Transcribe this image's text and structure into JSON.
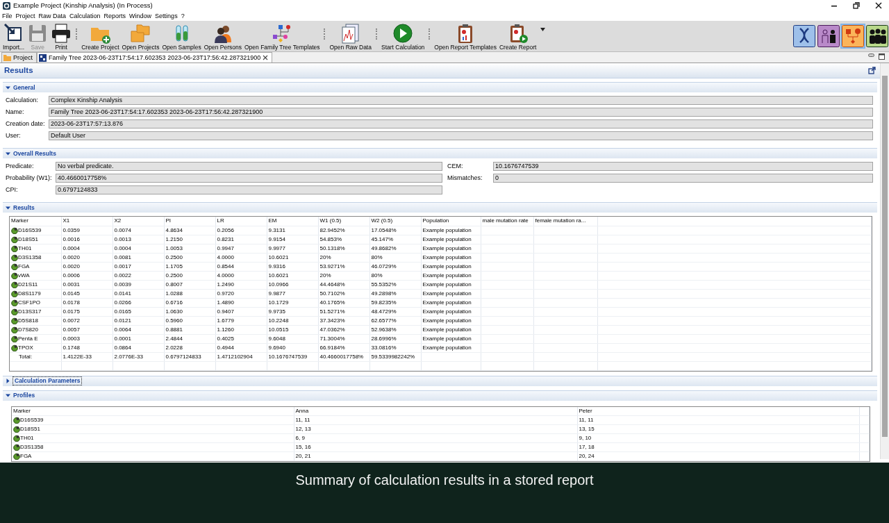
{
  "window": {
    "title": "Example Project (Kinship Analysis) (In Process)"
  },
  "menu": [
    "File",
    "Project",
    "Raw Data",
    "Calculation",
    "Reports",
    "Window",
    "Settings",
    "?"
  ],
  "toolbar_groups": [
    [
      {
        "label": "Import...",
        "disabled": false
      },
      {
        "label": "Save",
        "disabled": true
      },
      {
        "label": "Print",
        "disabled": false
      }
    ],
    [
      {
        "label": "Create Project",
        "disabled": false
      },
      {
        "label": "Open Projects",
        "disabled": false
      },
      {
        "label": "Open Samples",
        "disabled": false
      },
      {
        "label": "Open Persons",
        "disabled": false
      },
      {
        "label": "Open Family Tree Templates",
        "disabled": false
      }
    ],
    [
      {
        "label": "Open Raw Data",
        "disabled": false
      }
    ],
    [
      {
        "label": "Start Calculation",
        "disabled": false
      }
    ],
    [
      {
        "label": "Open Report Templates",
        "disabled": false
      },
      {
        "label": "Create Report",
        "disabled": false
      }
    ]
  ],
  "perspectives": [
    {
      "selected": false
    },
    {
      "selected": false
    },
    {
      "selected": true
    },
    {
      "selected": false
    }
  ],
  "tabs": [
    {
      "label": "Project",
      "selected": false,
      "closable": false
    },
    {
      "label": "Family Tree 2023-06-23T17:54:17.602353 2023-06-23T17:56:42.287321900",
      "selected": true,
      "closable": true
    }
  ],
  "page": {
    "title": "Results"
  },
  "sections": [
    {
      "kind": "form",
      "title": "General",
      "expanded": true,
      "focused": false,
      "fields": [
        {
          "label": "Calculation:",
          "value": "Complex Kinship Analysis"
        },
        {
          "label": "Name:",
          "value": "Family Tree 2023-06-23T17:54:17.602353 2023-06-23T17:56:42.287321900"
        },
        {
          "label": "Creation date:",
          "value": "2023-06-23T17:57:13.876"
        },
        {
          "label": "User:",
          "value": "Default User"
        }
      ]
    },
    {
      "kind": "pairs",
      "title": "Overall Results",
      "expanded": true,
      "focused": false,
      "left": [
        {
          "label": "Predicate:",
          "value": "No verbal predicate."
        },
        {
          "label": "Probability (W1):",
          "value": "40.4660017758%"
        },
        {
          "label": "CPI:",
          "value": "0.6797124833"
        }
      ],
      "right": [
        {
          "label": "CEM:",
          "value": "10.1676747539"
        },
        {
          "label": "Mismatches:",
          "value": "0"
        }
      ]
    },
    {
      "kind": "table",
      "title": "Results",
      "expanded": true,
      "focused": false,
      "columns": [
        "Marker",
        "X1",
        "X2",
        "PI",
        "LR",
        "EM",
        "W1 (0.5)",
        "W2 (0.5)",
        "Population",
        "male mutation rate",
        "female mutation ra..."
      ],
      "rows": [
        {
          "kind": "marker",
          "cells": [
            "D16S539",
            "0.0359",
            "0.0074",
            "4.8634",
            "0.2056",
            "9.3131",
            "82.9452%",
            "17.0548%",
            "Example population"
          ]
        },
        {
          "kind": "marker",
          "cells": [
            "D18S51",
            "0.0016",
            "0.0013",
            "1.2150",
            "0.8231",
            "9.9154",
            "54.853%",
            "45.147%",
            "Example population"
          ]
        },
        {
          "kind": "marker",
          "cells": [
            "TH01",
            "0.0004",
            "0.0004",
            "1.0053",
            "0.9947",
            "9.9977",
            "50.1318%",
            "49.8682%",
            "Example population"
          ]
        },
        {
          "kind": "marker",
          "cells": [
            "D3S1358",
            "0.0020",
            "0.0081",
            "0.2500",
            "4.0000",
            "10.6021",
            "20%",
            "80%",
            "Example population"
          ]
        },
        {
          "kind": "marker",
          "cells": [
            "FGA",
            "0.0020",
            "0.0017",
            "1.1705",
            "0.8544",
            "9.9316",
            "53.9271%",
            "46.0729%",
            "Example population"
          ]
        },
        {
          "kind": "marker",
          "cells": [
            "vWA",
            "0.0006",
            "0.0022",
            "0.2500",
            "4.0000",
            "10.6021",
            "20%",
            "80%",
            "Example population"
          ]
        },
        {
          "kind": "marker",
          "cells": [
            "D21S11",
            "0.0031",
            "0.0039",
            "0.8007",
            "1.2490",
            "10.0966",
            "44.4648%",
            "55.5352%",
            "Example population"
          ]
        },
        {
          "kind": "marker",
          "cells": [
            "D8S1179",
            "0.0145",
            "0.0141",
            "1.0288",
            "0.9720",
            "9.9877",
            "50.7102%",
            "49.2898%",
            "Example population"
          ]
        },
        {
          "kind": "marker",
          "cells": [
            "CSF1PO",
            "0.0178",
            "0.0266",
            "0.6716",
            "1.4890",
            "10.1729",
            "40.1765%",
            "59.8235%",
            "Example population"
          ]
        },
        {
          "kind": "marker",
          "cells": [
            "D13S317",
            "0.0175",
            "0.0165",
            "1.0630",
            "0.9407",
            "9.9735",
            "51.5271%",
            "48.4729%",
            "Example population"
          ]
        },
        {
          "kind": "marker",
          "cells": [
            "D5S818",
            "0.0072",
            "0.0121",
            "0.5960",
            "1.6779",
            "10.2248",
            "37.3423%",
            "62.6577%",
            "Example population"
          ]
        },
        {
          "kind": "marker",
          "cells": [
            "D7S820",
            "0.0057",
            "0.0064",
            "0.8881",
            "1.1260",
            "10.0515",
            "47.0362%",
            "52.9638%",
            "Example population"
          ]
        },
        {
          "kind": "marker",
          "cells": [
            "Penta E",
            "0.0003",
            "0.0001",
            "2.4844",
            "0.4025",
            "9.6048",
            "71.3004%",
            "28.6996%",
            "Example population"
          ]
        },
        {
          "kind": "marker",
          "cells": [
            "TPOX",
            "0.1748",
            "0.0864",
            "2.0228",
            "0.4944",
            "9.6940",
            "66.9184%",
            "33.0816%",
            "Example population"
          ]
        },
        {
          "kind": "total",
          "cells": [
            "Total:",
            "1.4122E-33",
            "2.0776E-33",
            "0.6797124833",
            "1.4712102904",
            "10.1676747539",
            "40.4660017758%",
            "59.5339982242%"
          ]
        }
      ]
    },
    {
      "title": "Calculation Parameters",
      "expanded": false,
      "focused": true
    },
    {
      "kind": "profiles",
      "title": "Profiles",
      "expanded": true,
      "focused": false,
      "columns": [
        "Marker",
        "Anna",
        "Peter"
      ],
      "rows": [
        {
          "kind": "marker",
          "cells": [
            "D16S539",
            "11, 11",
            "11, 11"
          ]
        },
        {
          "kind": "marker",
          "cells": [
            "D18S51",
            "12, 13",
            "13, 15"
          ]
        },
        {
          "kind": "marker",
          "cells": [
            "TH01",
            "6, 9",
            "9, 10"
          ]
        },
        {
          "kind": "marker",
          "cells": [
            "D3S1358",
            "15, 16",
            "17, 18"
          ]
        },
        {
          "kind": "marker",
          "cells": [
            "FGA",
            "20, 21",
            "20, 24"
          ]
        }
      ]
    }
  ],
  "caption": "Summary of calculation results in a stored report"
}
